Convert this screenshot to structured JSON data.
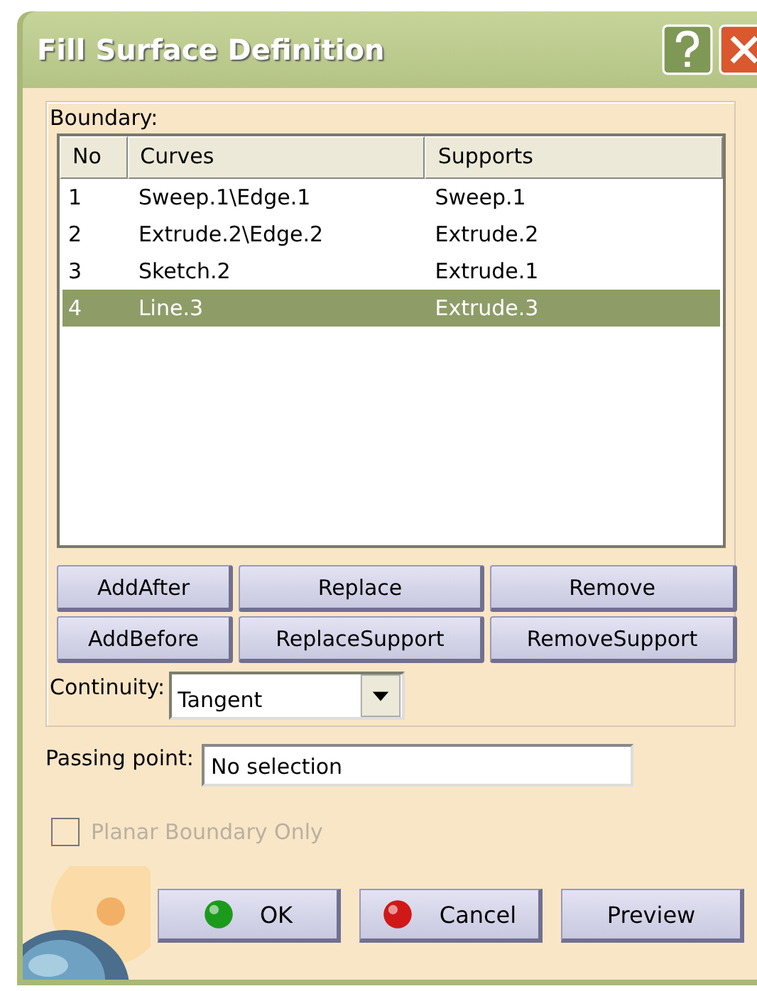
{
  "window": {
    "title": "Fill Surface Definition"
  },
  "boundary": {
    "label": "Boundary:",
    "columns": [
      "No",
      "Curves",
      "Supports"
    ],
    "rows": [
      {
        "cells": [
          "1",
          "Sweep.1\\Edge.1",
          "Sweep.1"
        ],
        "selected": false
      },
      {
        "cells": [
          "2",
          "Extrude.2\\Edge.2",
          "Extrude.2"
        ],
        "selected": false
      },
      {
        "cells": [
          "3",
          "Sketch.2",
          "Extrude.1"
        ],
        "selected": false
      },
      {
        "cells": [
          "4",
          "Line.3",
          "Extrude.3"
        ],
        "selected": true
      }
    ],
    "buttons": [
      [
        "AddAfter",
        "Replace",
        "Remove"
      ],
      [
        "AddBefore",
        "ReplaceSupport",
        "RemoveSupport"
      ]
    ],
    "continuity": {
      "label": "Continuity:",
      "value": "Tangent"
    }
  },
  "passing_point": {
    "label": "Passing point:",
    "value": "No selection"
  },
  "planar_boundary_only": {
    "label": "Planar Boundary Only",
    "checked": false,
    "disabled": true
  },
  "footer_buttons": [
    {
      "label": "OK",
      "kind": "ok"
    },
    {
      "label": "Cancel",
      "kind": "cancel"
    },
    {
      "label": "Preview",
      "kind": "plain"
    }
  ]
}
